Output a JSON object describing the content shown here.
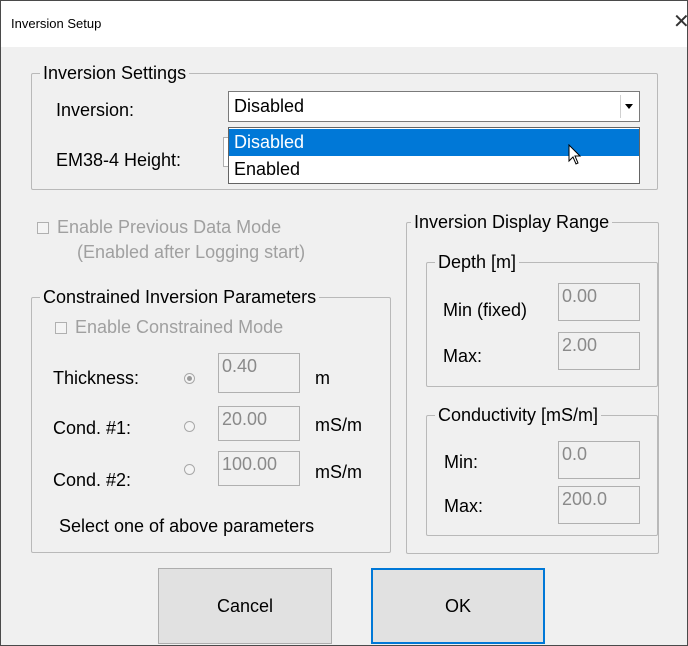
{
  "window": {
    "title": "Inversion Setup",
    "close_glyph": "✕"
  },
  "inversion_settings": {
    "legend": "Inversion Settings",
    "inversion_label": "Inversion:",
    "inversion_value": "Disabled",
    "height_label": "EM38-4 Height:",
    "dropdown_options": [
      "Disabled",
      "Enabled"
    ],
    "selected_option": "Disabled"
  },
  "previous_data": {
    "label": "Enable Previous Data Mode",
    "sublabel": "(Enabled after Logging start)",
    "checked": false,
    "enabled": false
  },
  "constrained": {
    "legend": "Constrained Inversion Parameters",
    "enable_label": "Enable Constrained Mode",
    "rows": [
      {
        "label": "Thickness:",
        "value": "0.40",
        "unit": "m",
        "selected": true
      },
      {
        "label": "Cond. #1:",
        "value": "20.00",
        "unit": "mS/m",
        "selected": false
      },
      {
        "label": "Cond. #2:",
        "value": "100.00",
        "unit": "mS/m",
        "selected": false
      }
    ],
    "hint": "Select one of above parameters"
  },
  "display_range": {
    "legend": "Inversion Display Range",
    "depth": {
      "legend": "Depth [m]",
      "min_label": "Min (fixed)",
      "min_value": "0.00",
      "max_label": "Max:",
      "max_value": "2.00"
    },
    "conductivity": {
      "legend": "Conductivity [mS/m]",
      "min_label": "Min:",
      "min_value": "0.0",
      "max_label": "Max:",
      "max_value": "200.0"
    }
  },
  "buttons": {
    "cancel": "Cancel",
    "ok": "OK"
  },
  "icons": {
    "close": "close-icon",
    "dropdown": "chevron-down-icon",
    "cursor": "mouse-pointer-icon"
  },
  "colors": {
    "selection": "#0078d7",
    "window_bg": "#f0f0f0",
    "disabled_text": "#a0a0a0"
  }
}
